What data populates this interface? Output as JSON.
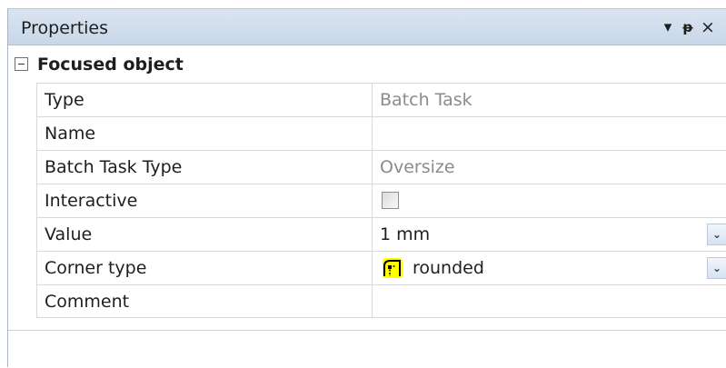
{
  "panel": {
    "title": "Properties",
    "buttons": {
      "menu": "▾",
      "pin": "ᵽ",
      "close": "×"
    }
  },
  "section": {
    "label": "Focused object",
    "expanded": true
  },
  "rows": [
    {
      "name": "Type",
      "value": "Batch Task",
      "readonly": true
    },
    {
      "name": "Name",
      "value": ""
    },
    {
      "name": "Batch Task Type",
      "value": "Oversize",
      "readonly": true
    },
    {
      "name": "Interactive",
      "checked": false
    },
    {
      "name": "Value",
      "value": "1 mm"
    },
    {
      "name": "Corner type",
      "value": "rounded",
      "icon": "rounded-corner-icon"
    },
    {
      "name": "Comment",
      "value": ""
    }
  ],
  "colors": {
    "titlebar": "#c7d6e8",
    "grid_line": "#d8d8d8",
    "readonly_text": "#8b8b8b",
    "corner_icon_fill": "#ffff00"
  }
}
